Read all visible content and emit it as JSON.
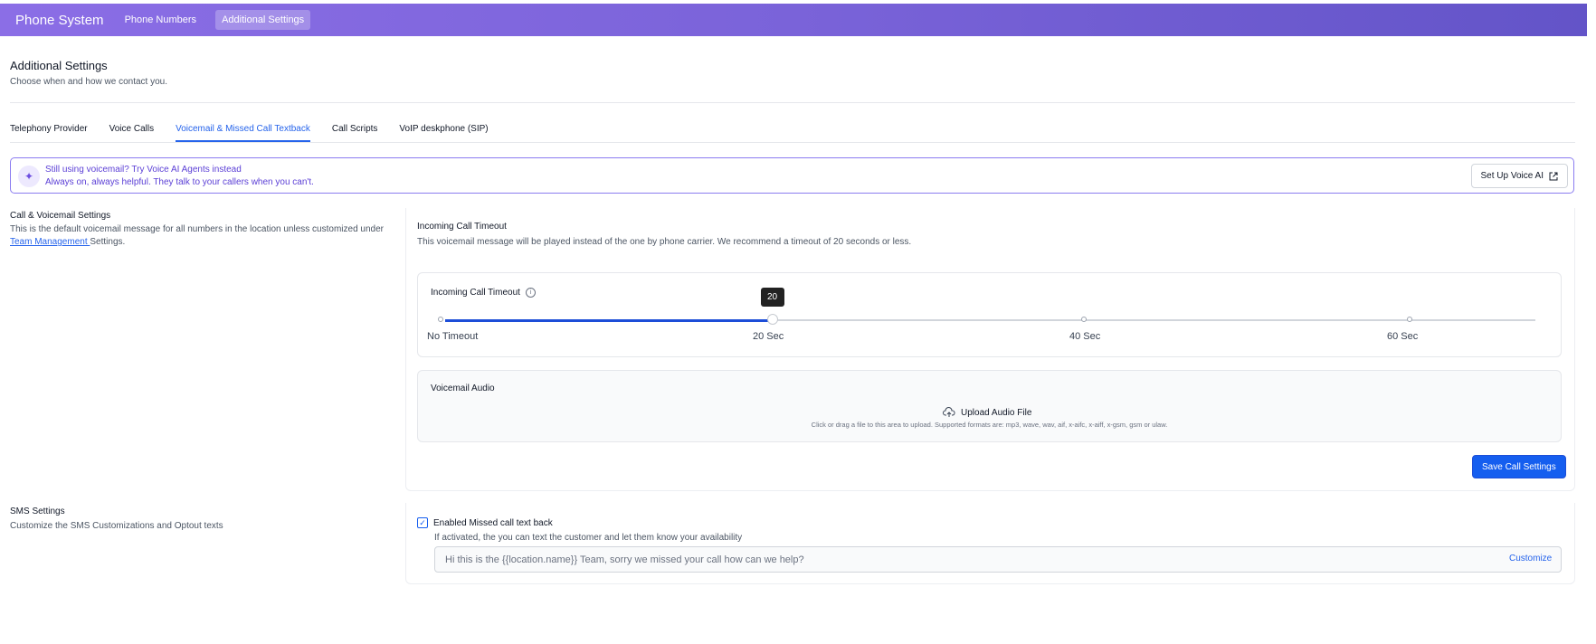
{
  "topbar": {
    "brand": "Phone System",
    "nav": [
      "Phone Numbers",
      "Additional Settings"
    ]
  },
  "page": {
    "title": "Additional Settings",
    "subtitle": "Choose when and how we contact you."
  },
  "tabs": [
    "Telephony Provider",
    "Voice Calls",
    "Voicemail & Missed Call Textback",
    "Call Scripts",
    "VoIP deskphone (SIP)"
  ],
  "active_tab": "Voicemail & Missed Call Textback",
  "banner": {
    "icon": "sparkle-icon",
    "title": "Still using voicemail? Try Voice AI Agents instead",
    "subtitle": "Always on, always helpful. They talk to your callers when you can't.",
    "button": "Set Up Voice AI"
  },
  "call_settings": {
    "label": "Call & Voicemail Settings",
    "desc_prefix": "This is the default voicemail message for all numbers in the location unless customized under ",
    "desc_link": "Team Management ",
    "desc_suffix": "Settings.",
    "timeout_title": "Incoming Call Timeout",
    "timeout_desc": "This voicemail message will be played instead of the one by phone carrier. We recommend a timeout of 20 seconds or less.",
    "slider": {
      "label": "Incoming Call Timeout",
      "value": 20,
      "max": 60,
      "tooltip": "20",
      "marks": [
        "No Timeout",
        "20 Sec",
        "40 Sec",
        "60 Sec"
      ]
    },
    "voicemail_audio": {
      "label": "Voicemail Audio",
      "upload_label": "Upload Audio File",
      "hint": "Click or drag a file to this area to upload. Supported formats are: mp3, wave, wav, aif, x-aifc, x-aiff, x-gsm, gsm or ulaw."
    },
    "save_button": "Save Call Settings"
  },
  "sms": {
    "label": "SMS Settings",
    "desc": "Customize the SMS Customizations and Optout texts",
    "checkbox_label": "Enabled Missed call text back",
    "checked": true,
    "checkbox_desc": "If activated, the you can text the customer and let them know your availability",
    "message": "Hi this is the {{location.name}} Team, sorry we missed your call how can we help?",
    "customize": "Customize"
  },
  "colors": {
    "accent": "#155eef",
    "banner_border": "#8b7cf0",
    "topbar_start": "#8b6ee6",
    "topbar_end": "#6354c8"
  }
}
